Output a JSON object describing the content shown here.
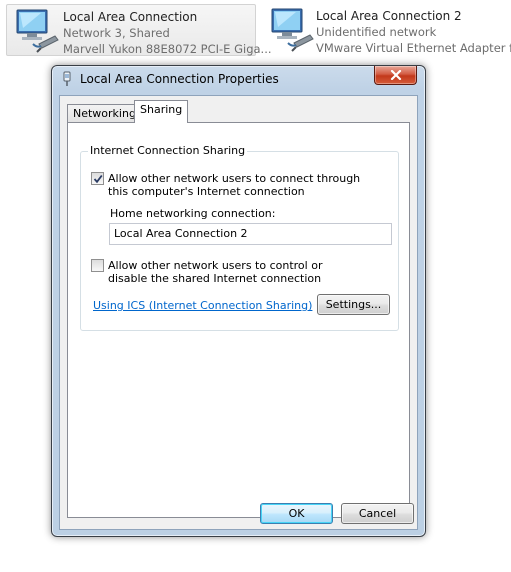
{
  "connections": [
    {
      "name": "Local Area Connection",
      "status": "Network  3, Shared",
      "adapter": "Marvell Yukon 88E8072 PCI-E Giga...",
      "selected": true
    },
    {
      "name": "Local Area Connection 2",
      "status": "Unidentified network",
      "adapter": "VMware Virtual Ethernet Adapter f...",
      "selected": false
    }
  ],
  "dialog": {
    "title": "Local Area Connection Properties",
    "close_icon": "close-icon",
    "tabs": [
      {
        "label": "Networking",
        "active": false
      },
      {
        "label": "Sharing",
        "active": true
      }
    ],
    "sharing": {
      "group_title": "Internet Connection Sharing",
      "allow_connect_label": "Allow other network users to connect through this computer's Internet connection",
      "allow_connect_checked": true,
      "home_network_label": "Home networking connection:",
      "home_network_value": "Local Area Connection 2",
      "allow_control_label": "Allow other network users to control or disable the shared Internet connection",
      "allow_control_checked": false,
      "help_link": "Using ICS (Internet Connection Sharing)",
      "settings_button": "Settings..."
    },
    "ok_button": "OK",
    "cancel_button": "Cancel"
  },
  "colors": {
    "link": "#0066cc",
    "close_button": "#c2381b",
    "window_frame": "#bfd2e6"
  }
}
